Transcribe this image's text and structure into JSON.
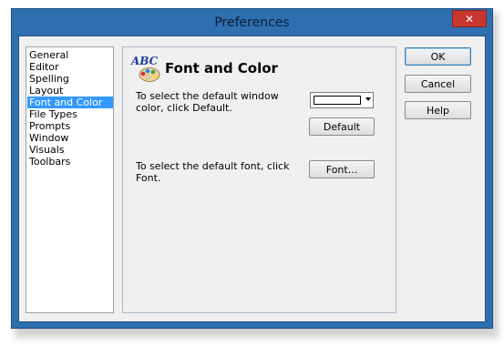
{
  "window": {
    "title": "Preferences",
    "close_label": "✕"
  },
  "sidebar": {
    "items": [
      {
        "label": "General",
        "selected": false
      },
      {
        "label": "Editor",
        "selected": false
      },
      {
        "label": "Spelling",
        "selected": false
      },
      {
        "label": "Layout",
        "selected": false
      },
      {
        "label": "Font and Color",
        "selected": true
      },
      {
        "label": "File Types",
        "selected": false
      },
      {
        "label": "Prompts",
        "selected": false
      },
      {
        "label": "Window",
        "selected": false
      },
      {
        "label": "Visuals",
        "selected": false
      },
      {
        "label": "Toolbars",
        "selected": false
      }
    ]
  },
  "panel": {
    "icon_text": "ABC",
    "heading": "Font and Color",
    "color_desc": "To select the default window color, click Default.",
    "color_value": "#ffffff",
    "default_label": "Default",
    "font_desc": "To select the default font, click Font.",
    "font_label": "Font..."
  },
  "actions": {
    "ok_label": "OK",
    "cancel_label": "Cancel",
    "help_label": "Help"
  },
  "colors": {
    "titlebar": "#2e6fb0",
    "selection": "#3399ff",
    "close": "#c7372f"
  }
}
